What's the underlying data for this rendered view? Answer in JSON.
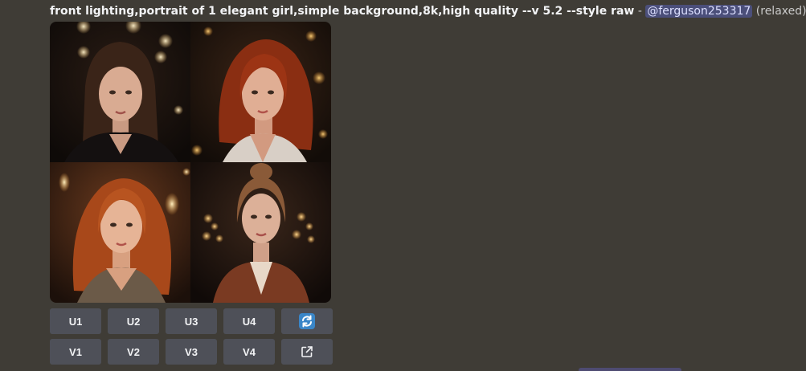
{
  "message": {
    "prompt": "front lighting,portrait of 1 elegant girl,simple background,8k,high quality --v 5.2 --style raw",
    "separator": " - ",
    "mention": "@ferguson253317",
    "status": " (relaxed)"
  },
  "upscale_buttons": [
    {
      "label": "U1"
    },
    {
      "label": "U2"
    },
    {
      "label": "U3"
    },
    {
      "label": "U4"
    }
  ],
  "variation_buttons": [
    {
      "label": "V1"
    },
    {
      "label": "V2"
    },
    {
      "label": "V3"
    },
    {
      "label": "V4"
    }
  ],
  "icons": {
    "reroll": "refresh-icon",
    "open": "external-link-icon"
  },
  "colors": {
    "background": "#3f3c36",
    "button": "#4e5058",
    "mention_bg": "#4b4f7a",
    "reroll_icon_bg": "#3a86c8"
  }
}
